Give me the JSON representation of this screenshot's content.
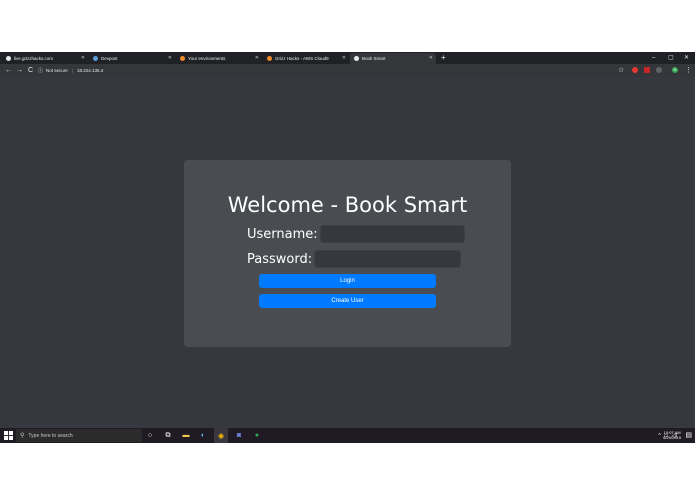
{
  "browser": {
    "tabs": [
      {
        "title": "live.grizzhacks.com",
        "active": false
      },
      {
        "title": "Devpost",
        "active": false
      },
      {
        "title": "Your environments",
        "active": false
      },
      {
        "title": "Grizz Hacks - AWS Cloud9",
        "active": false
      },
      {
        "title": "Book Smart",
        "active": true
      }
    ],
    "new_tab": "+",
    "window_controls": {
      "minimize": "–",
      "maximize": "▢",
      "close": "✕"
    },
    "toolbar": {
      "back": "←",
      "forward": "→",
      "reload": "C",
      "security_label": "Not secure",
      "url": "18.224.135.4",
      "star": "☆",
      "menu": "⋮",
      "profile_initial": "N"
    }
  },
  "page": {
    "title": "Welcome - Book Smart",
    "username_label": "Username:",
    "username_value": "",
    "password_label": "Password:",
    "password_value": "",
    "login_button": "Login",
    "create_user_button": "Create User"
  },
  "taskbar": {
    "search_placeholder": "Type here to search",
    "time": "10:07 AM",
    "date": "6/29/2019"
  },
  "colors": {
    "page_background": "#35393f",
    "card_background": "#494c50",
    "button_primary": "#007bff",
    "tab_strip": "#202124"
  }
}
